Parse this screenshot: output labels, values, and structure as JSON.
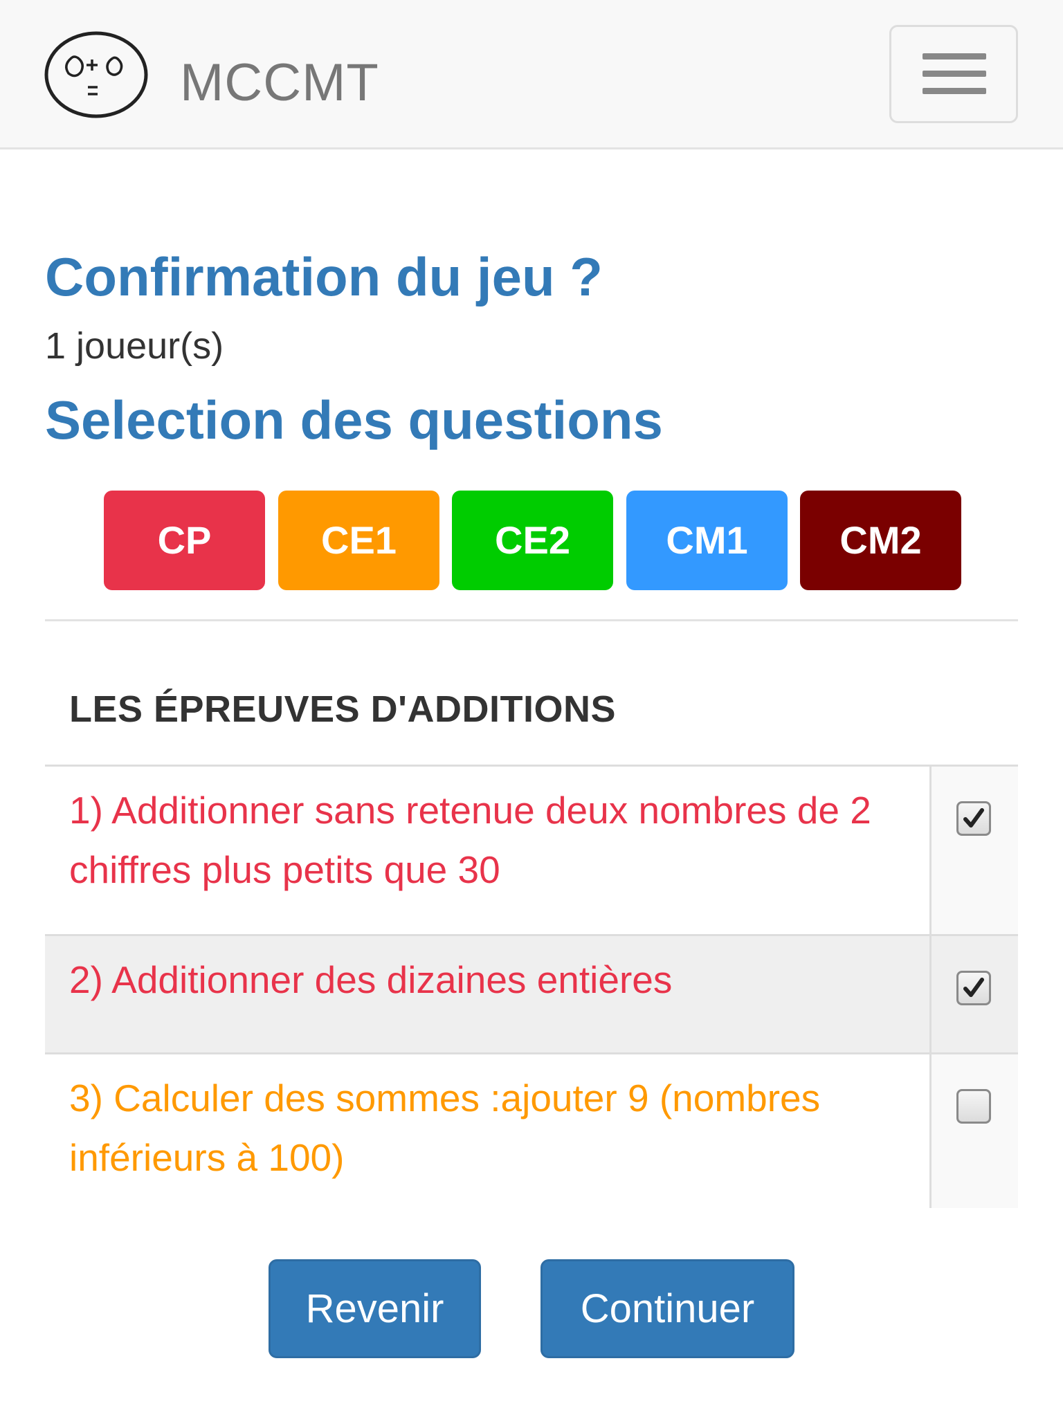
{
  "navbar": {
    "brand_title": "MCCMT",
    "logo_icon": "smiley-equation-logo",
    "menu_icon": "hamburger-menu-icon"
  },
  "main": {
    "confirm_heading": "Confirmation du jeu ?",
    "players_text": "1 joueur(s)",
    "selection_heading": "Selection des questions"
  },
  "levels": [
    {
      "label": "CP",
      "color": "#e8334a"
    },
    {
      "label": "CE1",
      "color": "#ff9900"
    },
    {
      "label": "CE2",
      "color": "#00cc00"
    },
    {
      "label": "CM1",
      "color": "#3399ff"
    },
    {
      "label": "CM2",
      "color": "#7a0000"
    }
  ],
  "section": {
    "title": "LES ÉPREUVES D'ADDITIONS"
  },
  "tasks": [
    {
      "text": "1) Additionner sans retenue deux nombres de 2 chiffres plus petits que 30",
      "color": "#e8334a",
      "checked": true
    },
    {
      "text": "2) Additionner des dizaines entières",
      "color": "#e8334a",
      "checked": true
    },
    {
      "text": "3) Calculer des sommes :ajouter 9 (nombres inférieurs à 100)",
      "color": "#ff9900",
      "checked": false
    }
  ],
  "actions": {
    "back_label": "Revenir",
    "continue_label": "Continuer"
  },
  "colors": {
    "heading": "#337ab7",
    "primary_button": "#337ab7"
  }
}
